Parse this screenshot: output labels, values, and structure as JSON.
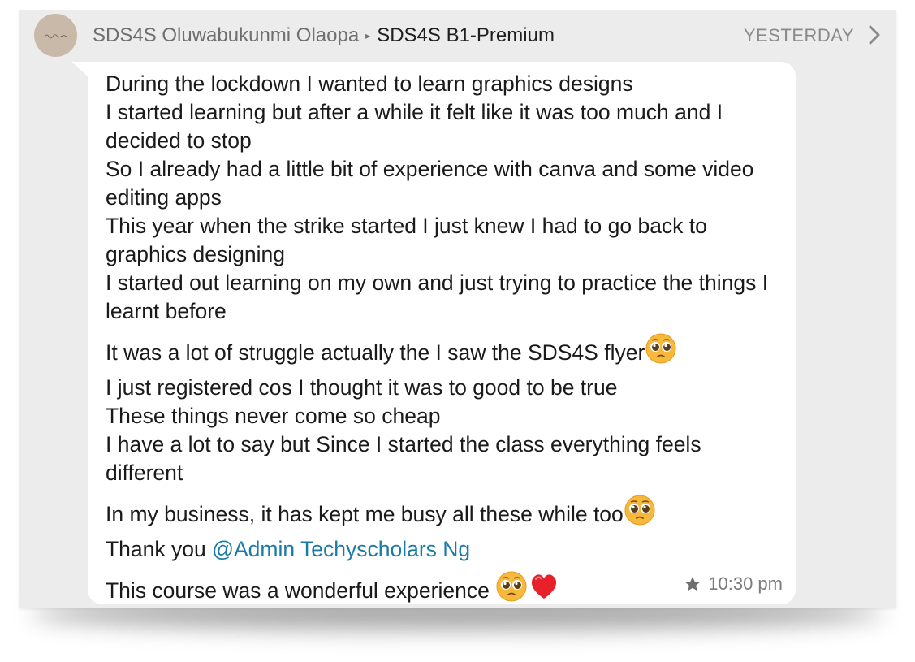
{
  "header": {
    "sender": "SDS4S Oluwabukunmi Olaopa",
    "separator": "▸",
    "group": "SDS4S B1-Premium",
    "date": "YESTERDAY"
  },
  "message": {
    "lines": [
      "During the lockdown I wanted to learn graphics designs",
      "I started learning but after a while it felt like it was too much and I decided to stop",
      "So I already had a little bit of experience with canva and some video editing apps",
      "This year when the strike started  I just knew I had to go back to graphics designing",
      "I started out learning on my own and just trying to practice the things I learnt before",
      "It was a lot of struggle actually the I saw the SDS4S flyer",
      "I just registered cos I thought it was to good to be true",
      "These things never come so cheap",
      "I have a lot to say but Since I started the class everything feels different",
      "In my business, it has kept me busy all these while too",
      "Thank you ",
      "@Admin Techyscholars Ng",
      "This course was a wonderful experience "
    ],
    "time": "10:30 pm"
  },
  "icons": {
    "avatar": "profile-avatar",
    "chevron": "chevron-right-icon",
    "star": "star-icon",
    "pleading": "pleading-face-emoji",
    "heart": "red-heart-emoji"
  },
  "colors": {
    "mention": "#1a7aa8",
    "background": "#ececec",
    "bubble": "#ffffff"
  }
}
